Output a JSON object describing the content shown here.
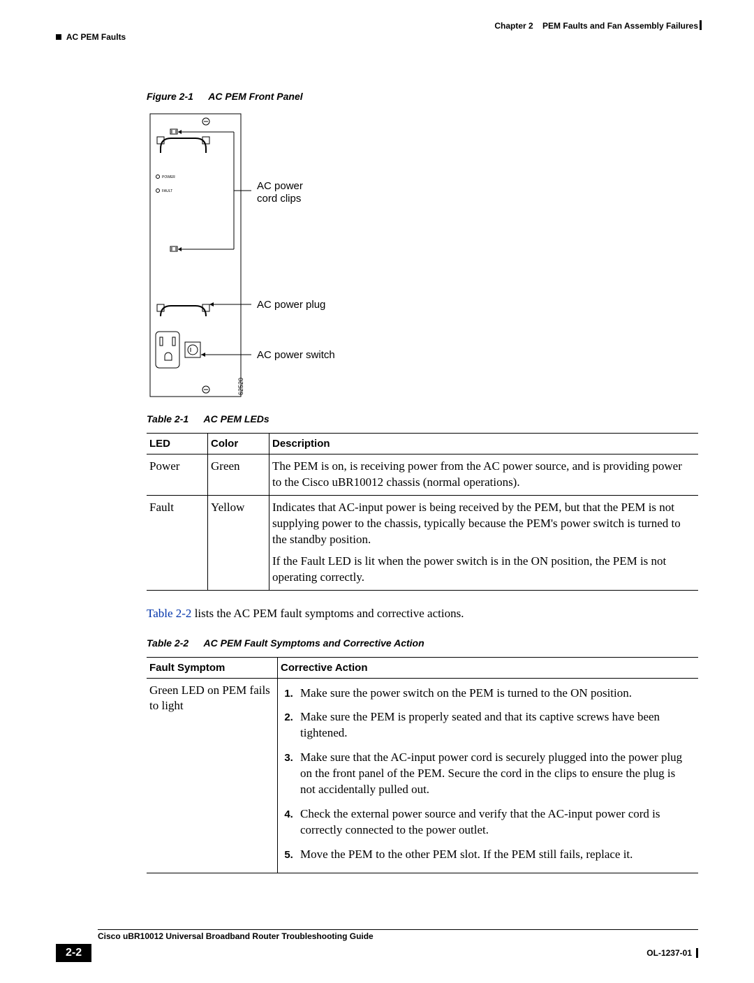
{
  "header": {
    "chapter_label": "Chapter 2",
    "chapter_title": "PEM Faults and Fan Assembly Failures",
    "section_title": "AC PEM Faults"
  },
  "figure1": {
    "caption_no": "Figure 2-1",
    "caption_title": "AC PEM Front Panel",
    "label_cord_clips": "AC power\ncord clips",
    "label_plug": "AC power plug",
    "label_switch": "AC power switch",
    "led_power": "POWER",
    "led_fault": "FAULT",
    "drawing_id": "62520"
  },
  "table1": {
    "caption_no": "Table 2-1",
    "caption_title": "AC PEM LEDs",
    "headers": {
      "led": "LED",
      "color": "Color",
      "desc": "Description"
    },
    "rows": [
      {
        "led": "Power",
        "color": "Green",
        "desc": "The PEM is on, is receiving power from the AC power source, and is providing power to the Cisco uBR10012 chassis (normal operations)."
      },
      {
        "led": "Fault",
        "color": "Yellow",
        "desc1": "Indicates that AC-input power is being received by the PEM, but that the PEM is not supplying power to the chassis, typically because the PEM's power switch is turned to the standby position.",
        "desc2": "If the Fault LED is lit when the power switch is in the ON position, the PEM is not operating correctly."
      }
    ]
  },
  "mid_text": {
    "link": "Table 2-2",
    "rest": " lists the AC PEM fault symptoms and corrective actions."
  },
  "table2": {
    "caption_no": "Table 2-2",
    "caption_title": "AC PEM Fault Symptoms and Corrective Action",
    "headers": {
      "fs": "Fault Symptom",
      "ca": "Corrective Action"
    },
    "row": {
      "symptom": "Green LED on PEM fails to light",
      "actions": [
        "Make sure the power switch on the PEM is turned to the ON position.",
        "Make sure the PEM is properly seated and that its captive screws have been tightened.",
        "Make sure that the AC-input power cord is securely plugged into the power plug on the front panel of the PEM. Secure the cord in the clips to ensure the plug is not accidentally pulled out.",
        "Check the external power source and verify that the AC-input power cord is correctly connected to the power outlet.",
        "Move the PEM to the other PEM slot. If the PEM still fails, replace it."
      ]
    }
  },
  "footer": {
    "book_title": "Cisco uBR10012 Universal Broadband Router Troubleshooting Guide",
    "page_number": "2-2",
    "doc_id": "OL-1237-01"
  }
}
